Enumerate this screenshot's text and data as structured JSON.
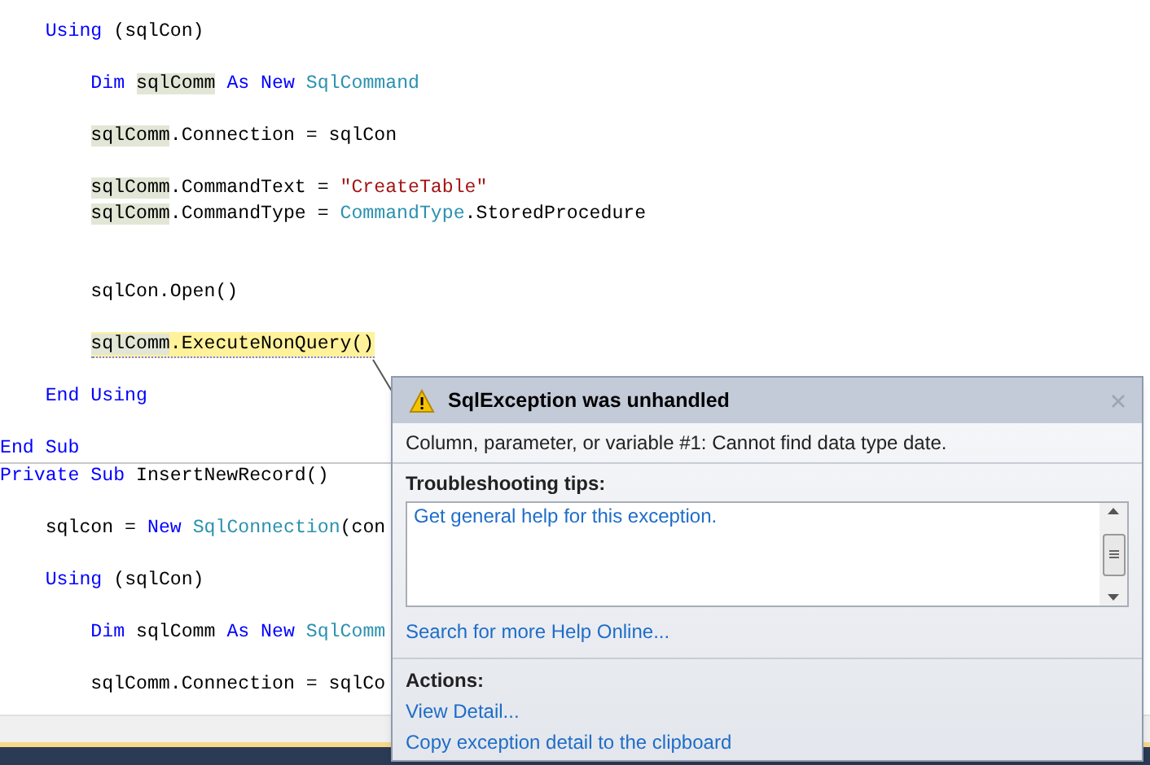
{
  "code_lines": [
    {
      "kind": "code",
      "tokens": [
        {
          "kind": "kw",
          "text": "    Using"
        },
        {
          "kind": "plain",
          "text": " (sqlCon)"
        }
      ]
    },
    {
      "kind": "blank"
    },
    {
      "kind": "code",
      "tokens": [
        {
          "kind": "kw",
          "text": "        Dim "
        },
        {
          "kind": "ref",
          "text": "sqlComm"
        },
        {
          "kind": "kw",
          "text": " As New "
        },
        {
          "kind": "type",
          "text": "SqlCommand"
        }
      ]
    },
    {
      "kind": "blank"
    },
    {
      "kind": "code",
      "tokens": [
        {
          "kind": "ref",
          "text": "        sqlComm"
        },
        {
          "kind": "plain",
          "text": ".Connection = sqlCon"
        }
      ]
    },
    {
      "kind": "blank"
    },
    {
      "kind": "code",
      "tokens": [
        {
          "kind": "ref",
          "text": "        sqlComm"
        },
        {
          "kind": "plain",
          "text": ".CommandText = "
        },
        {
          "kind": "str",
          "text": "\"CreateTable\""
        }
      ]
    },
    {
      "kind": "code",
      "tokens": [
        {
          "kind": "ref",
          "text": "        sqlComm"
        },
        {
          "kind": "plain",
          "text": ".CommandType = "
        },
        {
          "kind": "type",
          "text": "CommandType"
        },
        {
          "kind": "plain",
          "text": ".StoredProcedure"
        }
      ]
    },
    {
      "kind": "blank"
    },
    {
      "kind": "blank"
    },
    {
      "kind": "code",
      "tokens": [
        {
          "kind": "plain",
          "text": "        sqlCon.Open()"
        }
      ]
    },
    {
      "kind": "blank"
    },
    {
      "kind": "current",
      "tokens": [
        {
          "kind": "ref",
          "text": "        sqlComm"
        },
        {
          "kind": "plain",
          "text": ".ExecuteNonQuery()"
        }
      ]
    },
    {
      "kind": "blank"
    },
    {
      "kind": "code",
      "tokens": [
        {
          "kind": "kw",
          "text": "    End Using"
        }
      ]
    },
    {
      "kind": "blank"
    },
    {
      "kind": "code",
      "tokens": [
        {
          "kind": "kw",
          "text": "End Sub"
        }
      ]
    },
    {
      "kind": "separator"
    },
    {
      "kind": "code",
      "tokens": [
        {
          "kind": "kw",
          "text": "Private Sub"
        },
        {
          "kind": "plain",
          "text": " InsertNewRecord()"
        }
      ]
    },
    {
      "kind": "blank"
    },
    {
      "kind": "code",
      "tokens": [
        {
          "kind": "plain",
          "text": "    sqlcon = "
        },
        {
          "kind": "kw",
          "text": "New "
        },
        {
          "kind": "type",
          "text": "SqlConnection"
        },
        {
          "kind": "plain",
          "text": "(con"
        }
      ]
    },
    {
      "kind": "blank"
    },
    {
      "kind": "code",
      "tokens": [
        {
          "kind": "kw",
          "text": "    Using"
        },
        {
          "kind": "plain",
          "text": " (sqlCon)"
        }
      ]
    },
    {
      "kind": "blank"
    },
    {
      "kind": "code",
      "tokens": [
        {
          "kind": "kw",
          "text": "        Dim"
        },
        {
          "kind": "plain",
          "text": " sqlComm "
        },
        {
          "kind": "kw",
          "text": "As New "
        },
        {
          "kind": "type",
          "text": "SqlComm"
        }
      ]
    },
    {
      "kind": "blank"
    },
    {
      "kind": "code",
      "tokens": [
        {
          "kind": "plain",
          "text": "        sqlComm.Connection = sqlCo"
        }
      ]
    }
  ],
  "exception_popup": {
    "title": "SqlException was unhandled",
    "message": "Column, parameter, or variable #1: Cannot find data type date.",
    "tips_heading": "Troubleshooting tips:",
    "tips": [
      "Get general help for this exception."
    ],
    "search_link": "Search for more Help Online...",
    "actions_heading": "Actions:",
    "actions": [
      "View Detail...",
      "Copy exception detail to the clipboard"
    ]
  }
}
